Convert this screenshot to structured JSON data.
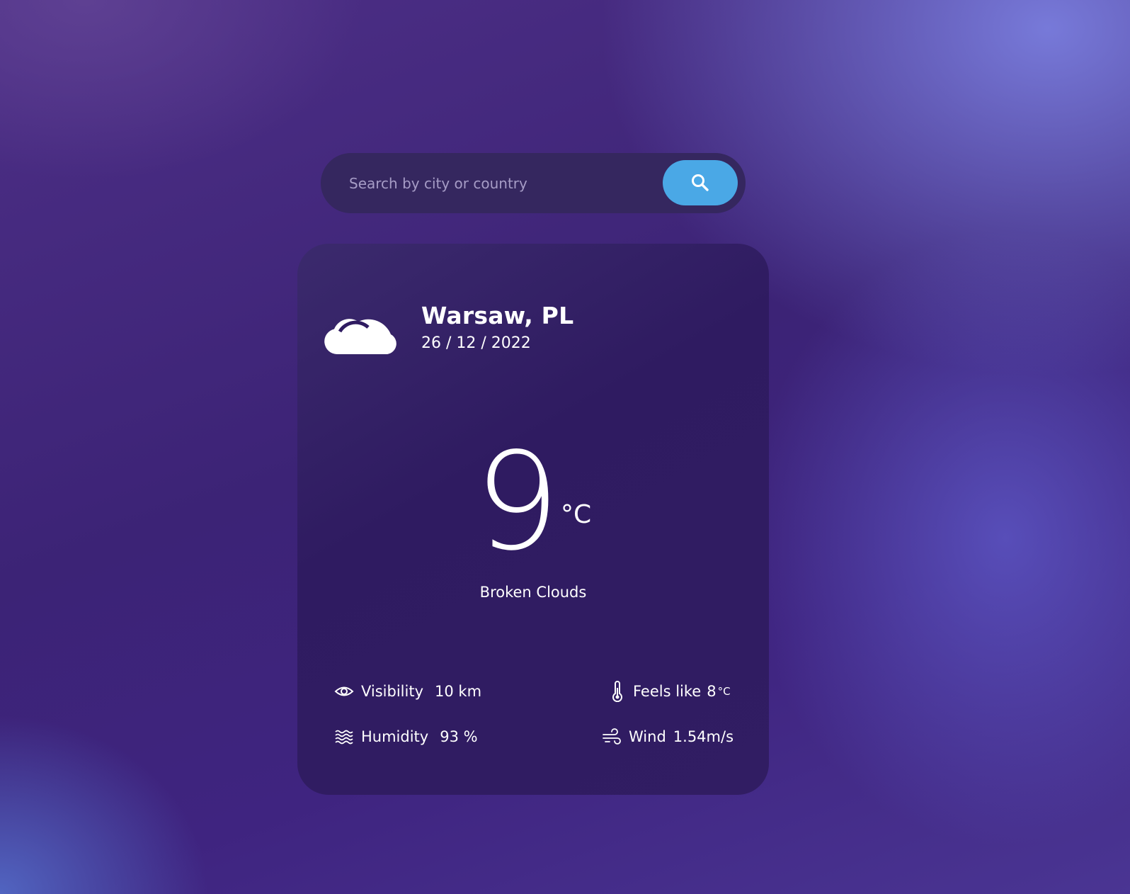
{
  "search": {
    "placeholder": "Search by city or country",
    "value": "",
    "button_icon": "search-icon",
    "button_color": "#4aa8e6"
  },
  "weather": {
    "icon": "cloud-icon",
    "city": "Warsaw, PL",
    "date": "26 / 12 / 2022",
    "temperature": "9",
    "temperature_unit": "°C",
    "condition": "Broken Clouds"
  },
  "details": {
    "visibility": {
      "icon": "eye-icon",
      "label": "Visibility",
      "value": "10 km"
    },
    "feels_like": {
      "icon": "thermometer-icon",
      "label": "Feels like",
      "value": "8",
      "unit": "°C"
    },
    "humidity": {
      "icon": "waves-icon",
      "label": "Humidity",
      "value": "93 %"
    },
    "wind": {
      "icon": "wind-icon",
      "label": "Wind",
      "value": "1.54m/s"
    }
  },
  "colors": {
    "card": "#2f1b61",
    "search_bar": "#35275f",
    "accent": "#4aa8e6",
    "text": "#ffffff"
  }
}
